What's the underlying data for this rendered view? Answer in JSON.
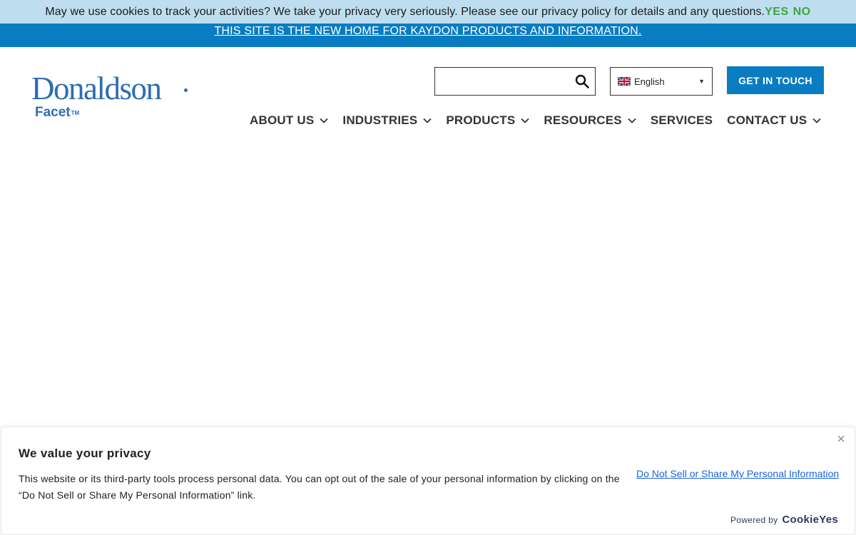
{
  "cookie_bar": {
    "message": "May we use cookies to track your activities? We take your privacy very seriously. Please see our privacy policy for details and any questions.",
    "yes_label": "YES",
    "no_label": "NO",
    "accent_color": "#3aa63a"
  },
  "top_banner": {
    "link_text": "THIS SITE IS THE NEW HOME FOR KAYDON PRODUCTS AND INFORMATION.",
    "background_color": "#0a7cc1"
  },
  "logo": {
    "brand": "Donaldson",
    "product": "Facet",
    "trademark": "TM"
  },
  "header": {
    "search_placeholder": "",
    "search_icon": "search-icon",
    "language": "English",
    "language_flag": "uk-flag-icon",
    "cta_label": "GET IN TOUCH"
  },
  "nav": {
    "items": [
      {
        "label": "ABOUT US",
        "has_dropdown": true
      },
      {
        "label": "INDUSTRIES",
        "has_dropdown": true
      },
      {
        "label": "PRODUCTS",
        "has_dropdown": true
      },
      {
        "label": "RESOURCES",
        "has_dropdown": true
      },
      {
        "label": "SERVICES",
        "has_dropdown": false
      },
      {
        "label": "CONTACT US",
        "has_dropdown": true
      }
    ]
  },
  "privacy_panel": {
    "title": "We value your privacy",
    "body": "This website or its third-party tools process personal data. You can opt out of the sale of your personal information by clicking on the “Do Not Sell or Share My Personal Information” link.",
    "link_text": "Do Not Sell or Share My Personal Information",
    "powered_by": "Powered by",
    "powered_brand": "CookieYes",
    "close_icon": "close-icon"
  }
}
